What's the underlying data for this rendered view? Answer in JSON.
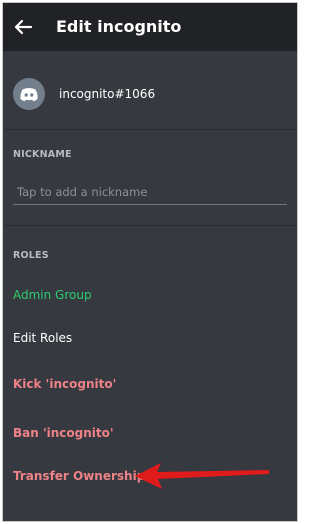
{
  "header": {
    "title": "Edit incognito",
    "back_icon": "arrow-left-icon"
  },
  "user": {
    "name": "incognito#1066",
    "avatar_icon": "discord-logo-icon",
    "avatar_color": "#747f8d"
  },
  "nickname": {
    "section_label": "NICKNAME",
    "placeholder": "Tap to add a nickname",
    "value": ""
  },
  "roles": {
    "section_label": "ROLES",
    "items": [
      {
        "label": "Admin Group",
        "color": "#2ecc71"
      },
      {
        "label": "Edit Roles",
        "color": "#ffffff"
      }
    ]
  },
  "actions": {
    "kick_label": "Kick 'incognito'",
    "ban_label": "Ban 'incognito'",
    "transfer_label": "Transfer Ownership",
    "danger_color": "#ed8287"
  },
  "annotation": {
    "arrow_icon": "red-pointer-arrow-icon",
    "arrow_color": "#e01b1b"
  },
  "theme": {
    "background": "#36393f",
    "appbar": "#202225"
  }
}
